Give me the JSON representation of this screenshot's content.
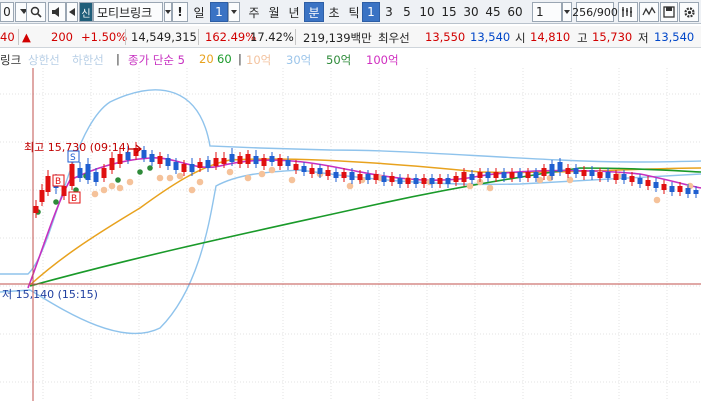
{
  "toolbar": {
    "code_value": "0",
    "search_icon": "search-icon",
    "speaker_icon": "speaker-icon",
    "arrow_icon": "arrow-icon",
    "stock_badge": "신",
    "stock_name": "모티브링크",
    "alert_label": "!",
    "period_selected": "일",
    "period_num": "1",
    "periods": [
      "주",
      "월",
      "년",
      "분",
      "초",
      "틱"
    ],
    "intervals": [
      "1",
      "3",
      "5",
      "10",
      "15",
      "30",
      "45",
      "60"
    ],
    "interval_input": "1",
    "page_count": "256/900",
    "tools_icon": "tools-icon",
    "pattern_icon": "pattern-icon",
    "save_icon": "save-icon",
    "settings_icon": "settings-icon"
  },
  "quote": {
    "price": "40",
    "change": "200",
    "change_rate": "+1.50%",
    "volume": "14,549,315",
    "volume_ratio": "162.49%",
    "turnover": "17.42%",
    "amount": "219,139백만",
    "best_ask_label": "최우선",
    "ask": "13,550",
    "bid": "13,540",
    "open_label": "시",
    "open": "14,810",
    "high_label": "고",
    "high": "15,730",
    "low_label": "저",
    "low": "13,540"
  },
  "legend": {
    "name_cut": "링크",
    "upper_limit": "상한선",
    "lower_limit": "하한선",
    "close_ma": "종가 단순 5",
    "ma20": "20",
    "ma60": "60",
    "v10": "10억",
    "v30": "30억",
    "v50": "50억",
    "v100": "100억"
  },
  "chart_data": {
    "type": "candlestick",
    "ylim": [
      15000,
      15900
    ],
    "annotations": {
      "high_label": "최고 15,730 (09:14)",
      "high_value": 15730,
      "low_label": "저 15,140 (15:15)",
      "low_value": 15140,
      "markers": [
        "S",
        "B",
        "B"
      ]
    },
    "colors": {
      "up": "#e01010",
      "down": "#1f5fd0",
      "ma5": "#c72fc0",
      "ma20": "#e8a21e",
      "ma60": "#1a9a2a",
      "band": "#8fc3ec",
      "dots": "#f5c29a",
      "green_dots": "#2e8b3a"
    }
  }
}
